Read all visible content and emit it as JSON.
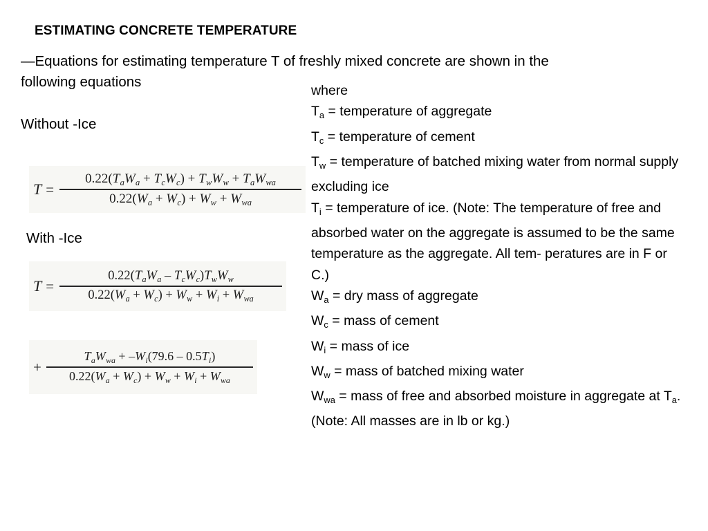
{
  "slide": {
    "title": "ESTIMATING CONCRETE TEMPERATURE",
    "intro": "—Equations for estimating temperature T of freshly mixed concrete are shown in the following equations",
    "label_without_ice": "Without -Ice",
    "label_with_ice": "With -Ice"
  },
  "equations": {
    "without_ice": {
      "lhs": "T",
      "relation": "=",
      "numerator_plain": "0.22(TaWa + TcWc) + TwWw + TaWwa",
      "denominator_plain": "0.22(Wa + Wc) + Ww + Wwa",
      "num": {
        "c1": "0.22(",
        "v1": "T",
        "s1": "a",
        "v2": "W",
        "s2": "a",
        "op1": " + ",
        "v3": "T",
        "s3": "c",
        "v4": "W",
        "s4": "c",
        "c2": ") + ",
        "v5": "T",
        "s5": "w",
        "v6": "W",
        "s6": "w",
        "op2": " + ",
        "v7": "T",
        "s7": "a",
        "v8": "W",
        "s8": "wa"
      },
      "den": {
        "c1": "0.22(",
        "v1": "W",
        "s1": "a",
        "op1": " + ",
        "v2": "W",
        "s2": "c",
        "c2": ") + ",
        "v3": "W",
        "s3": "w",
        "op2": " + ",
        "v4": "W",
        "s4": "wa"
      }
    },
    "with_ice_part1": {
      "lhs": "T",
      "relation": "=",
      "numerator_plain": "0.22(TaWa − TcWc)TwWw",
      "denominator_plain": "0.22(Wa + Wc) + Ww + Wi + Wwa",
      "num": {
        "c1": "0.22(",
        "v1": "T",
        "s1": "a",
        "v2": "W",
        "s2": "a",
        "op1": " – ",
        "v3": "T",
        "s3": "c",
        "v4": "W",
        "s4": "c",
        "c2": ")",
        "v5": "T",
        "s5": "w",
        "v6": "W",
        "s6": "w"
      },
      "den": {
        "c1": "0.22(",
        "v1": "W",
        "s1": "a",
        "op1": " + ",
        "v2": "W",
        "s2": "c",
        "c2": ") + ",
        "v3": "W",
        "s3": "w",
        "op2": " + ",
        "v4": "W",
        "s4": "i",
        "op3": " + ",
        "v5": "W",
        "s5": "wa"
      }
    },
    "with_ice_part2": {
      "leading_operator": "+",
      "numerator_plain": "TaWwa + −Wi(79.6 − 0.5Ti)",
      "denominator_plain": "0.22(Wa + Wc) + Ww + Wi + Wwa",
      "num": {
        "v1": "T",
        "s1": "a",
        "v2": "W",
        "s2": "wa",
        "op1": " + –",
        "v3": "W",
        "s3": "i",
        "c1": "(79.6 – 0.5",
        "v4": "T",
        "s4": "i",
        "c2": ")"
      },
      "den": {
        "c1": "0.22(",
        "v1": "W",
        "s1": "a",
        "op1": " + ",
        "v2": "W",
        "s2": "c",
        "c2": ") + ",
        "v3": "W",
        "s3": "w",
        "op2": " + ",
        "v4": "W",
        "s4": "i",
        "op3": " + ",
        "v5": "W",
        "s5": "wa"
      }
    }
  },
  "where": {
    "heading": "where",
    "definitions": [
      {
        "symbol": "T",
        "sub": "a",
        "text": " = temperature of aggregate"
      },
      {
        "symbol": "T",
        "sub": "c",
        "text": " = temperature of cement"
      },
      {
        "symbol": "T",
        "sub": "w",
        "text": " = temperature of batched mixing water from normal supply excluding ice"
      },
      {
        "symbol": "T",
        "sub": "i",
        "text": " = temperature of ice. (Note: The temperature of free and absorbed water on the aggregate is assumed to be the same temperature as the aggregate. All tem- peratures are in F or C.)"
      },
      {
        "symbol": "W",
        "sub": "a",
        "text": " = dry mass of aggregate"
      },
      {
        "symbol": "W",
        "sub": "c",
        "text": " = mass of cement"
      },
      {
        "symbol": "W",
        "sub": "i",
        "text": " = mass of ice"
      },
      {
        "symbol": "W",
        "sub": "w",
        "text": " = mass of batched mixing water"
      },
      {
        "symbol": "W",
        "sub": "wa",
        "text": " = mass of free and absorbed moisture in aggregate at ",
        "tail_symbol": "T",
        "tail_sub": "a",
        "tail_text": ". (Note: All masses are in lb or kg.)"
      }
    ]
  }
}
